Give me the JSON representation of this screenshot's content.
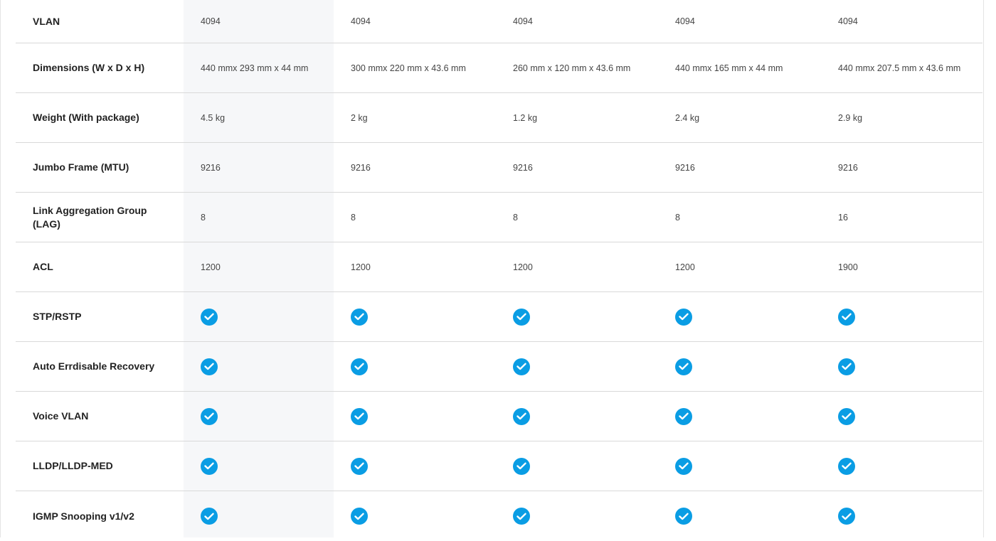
{
  "colors": {
    "check_blue": "#0a9de4",
    "highlight_column_bg": "#f6f7f9",
    "row_divider": "#d9d9d9"
  },
  "icons": {
    "supported": "check-circle-icon"
  },
  "rows": [
    {
      "label": "VLAN",
      "values": [
        "4094",
        "4094",
        "4094",
        "4094",
        "4094"
      ]
    },
    {
      "label": "Dimensions (W x D x H)",
      "values": [
        "440 mmx 293 mm x 44 mm",
        "300 mmx 220 mm x 43.6 mm",
        "260 mm x 120 mm x 43.6 mm",
        "440 mmx 165 mm x 44 mm",
        "440 mmx 207.5 mm x 43.6 mm"
      ]
    },
    {
      "label": "Weight (With package)",
      "values": [
        "4.5 kg",
        "2 kg",
        "1.2 kg",
        "2.4 kg",
        "2.9 kg"
      ]
    },
    {
      "label": "Jumbo Frame (MTU)",
      "values": [
        "9216",
        "9216",
        "9216",
        "9216",
        "9216"
      ]
    },
    {
      "label": "Link Aggregation Group (LAG)",
      "values": [
        "8",
        "8",
        "8",
        "8",
        "16"
      ]
    },
    {
      "label": "ACL",
      "values": [
        "1200",
        "1200",
        "1200",
        "1200",
        "1900"
      ]
    },
    {
      "label": "STP/RSTP",
      "supported": [
        true,
        true,
        true,
        true,
        true
      ]
    },
    {
      "label": "Auto Errdisable Recovery",
      "supported": [
        true,
        true,
        true,
        true,
        true
      ]
    },
    {
      "label": "Voice VLAN",
      "supported": [
        true,
        true,
        true,
        true,
        true
      ]
    },
    {
      "label": "LLDP/LLDP-MED",
      "supported": [
        true,
        true,
        true,
        true,
        true
      ]
    },
    {
      "label": "IGMP Snooping v1/v2",
      "supported": [
        true,
        true,
        true,
        true,
        true
      ]
    }
  ]
}
